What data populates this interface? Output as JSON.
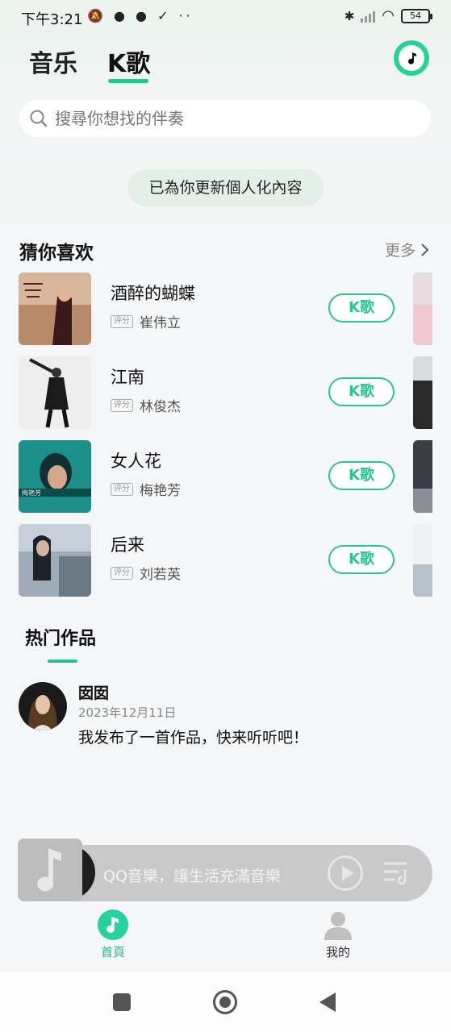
{
  "status_bar": {
    "time": "下午3:21",
    "battery": "54"
  },
  "header": {
    "tabs": [
      {
        "label": "音乐",
        "active": false
      },
      {
        "label": "K歌",
        "active": true
      }
    ]
  },
  "search": {
    "placeholder": "搜尋你想找的伴奏"
  },
  "toast": {
    "text": "已為你更新個人化內容"
  },
  "recommend": {
    "title": "猜你喜欢",
    "more_label": "更多",
    "badge_label": "评分",
    "k_label": "K歌",
    "songs": [
      {
        "title": "酒醉的蝴蝶",
        "artist": "崔伟立"
      },
      {
        "title": "江南",
        "artist": "林俊杰"
      },
      {
        "title": "女人花",
        "artist": "梅艳芳"
      },
      {
        "title": "后来",
        "artist": "刘若英"
      }
    ]
  },
  "hot": {
    "title": "热门作品",
    "post": {
      "user": "囡囡",
      "date": "2023年12月11日",
      "text": "我发布了一首作品，快来听听吧！"
    }
  },
  "player": {
    "text": "QQ音樂，讓生活充滿音樂"
  },
  "bottom_nav": {
    "items": [
      {
        "label": "首頁",
        "active": true
      },
      {
        "label": "我的",
        "active": false
      }
    ]
  },
  "colors": {
    "accent": "#27d19a",
    "k_button": "#2bc690"
  }
}
